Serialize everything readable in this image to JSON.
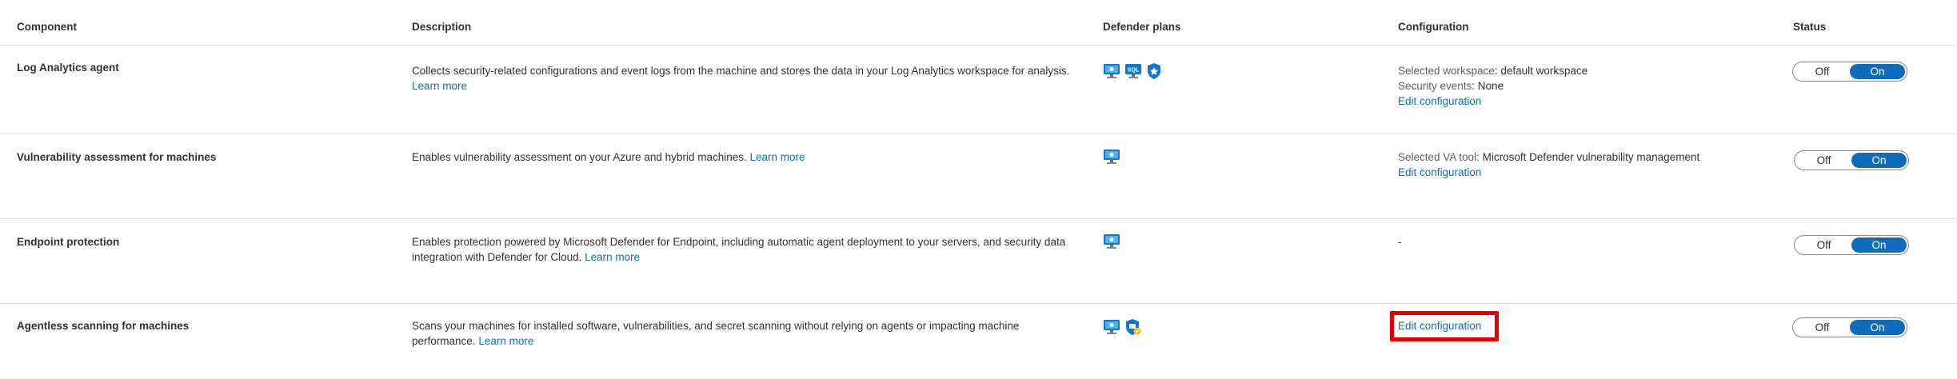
{
  "headers": {
    "component": "Component",
    "description": "Description",
    "plans": "Defender plans",
    "configuration": "Configuration",
    "status": "Status"
  },
  "rows": [
    {
      "component": "Log Analytics agent",
      "description": "Collects security-related configurations and event logs from the machine and stores the data in your Log Analytics workspace for analysis.",
      "learn_more": "Learn more",
      "plan_icons": [
        "servers-icon",
        "sql-icon",
        "shield-icon"
      ],
      "config": {
        "line1_label": "Selected workspace",
        "line1_value": ": default workspace",
        "line2_label": "Security events",
        "line2_value": ": None",
        "edit": "Edit configuration"
      },
      "status": {
        "off": "Off",
        "on": "On",
        "value": "On"
      }
    },
    {
      "component": "Vulnerability assessment for machines",
      "description": "Enables vulnerability assessment on your Azure and hybrid machines.",
      "learn_more": "Learn more",
      "plan_icons": [
        "servers-icon"
      ],
      "config": {
        "line1_label": "Selected VA tool",
        "line1_value": ": Microsoft Defender vulnerability management",
        "edit": "Edit configuration"
      },
      "status": {
        "off": "Off",
        "on": "On",
        "value": "On"
      }
    },
    {
      "component": "Endpoint protection",
      "description": "Enables protection powered by Microsoft Defender for Endpoint, including automatic agent deployment to your servers, and security data integration with Defender for Cloud.",
      "learn_more": "Learn more",
      "plan_icons": [
        "servers-icon"
      ],
      "config": {
        "text": "-"
      },
      "status": {
        "off": "Off",
        "on": "On",
        "value": "On"
      }
    },
    {
      "component": "Agentless scanning for machines",
      "description": "Scans your machines for installed software, vulnerabilities, and secret scanning without relying on agents or impacting machine performance.",
      "learn_more": "Learn more",
      "plan_icons": [
        "servers-icon",
        "cspm-shield-icon"
      ],
      "config": {
        "edit": "Edit configuration"
      },
      "status": {
        "off": "Off",
        "on": "On",
        "value": "On"
      }
    }
  ],
  "colors": {
    "link": "#0f6cbd",
    "toggle_on": "#0f6cbd",
    "highlight": "#e60000",
    "divider": "#e1dfdd"
  }
}
